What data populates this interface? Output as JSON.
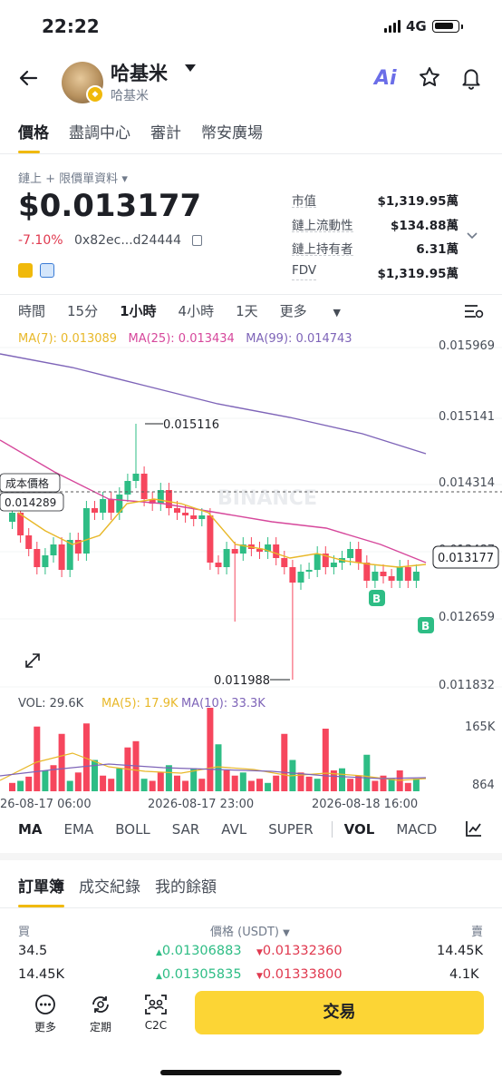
{
  "status_bar": {
    "time": "22:22",
    "network": "4G"
  },
  "header": {
    "token_name": "哈基米",
    "token_sub": "哈基米",
    "ai_label": "Ai",
    "icons": [
      "back-arrow-icon",
      "star-icon",
      "bell-icon"
    ]
  },
  "tabs": [
    "價格",
    "盡調中心",
    "審計",
    "幣安廣場"
  ],
  "price_section": {
    "source_label": "鏈上 + 限價單資料",
    "price": "$0.013177",
    "change": "-7.10%",
    "address": "0x82ec...d24444"
  },
  "stats": [
    {
      "label": "市值",
      "value": "$1,319.95萬"
    },
    {
      "label": "鏈上流動性",
      "value": "$134.88萬"
    },
    {
      "label": "鏈上持有者",
      "value": "6.31萬"
    },
    {
      "label": "FDV",
      "value": "$1,319.95萬"
    }
  ],
  "intervals": [
    "時間",
    "15分",
    "1小時",
    "4小時",
    "1天",
    "更多"
  ],
  "active_interval": "1小時",
  "ma_legend": {
    "ma7": "MA(7): 0.013089",
    "ma25": "MA(25): 0.013434",
    "ma99": "MA(99): 0.014743",
    "colors": {
      "ma7": "#e8b829",
      "ma25": "#d6479b",
      "ma99": "#7e64b8"
    }
  },
  "chart_data": {
    "type": "candlestick",
    "y_ticks": [
      "0.015969",
      "0.015141",
      "0.014314",
      "0.013487",
      "0.012659",
      "0.011832"
    ],
    "high_label": "0.015116",
    "low_label": "0.011988",
    "cost_label": "成本價格",
    "cost_value": "0.014289",
    "current_value": "0.013177",
    "x_ticks": [
      "26-08-17 06:00",
      "2026-08-17 23:00",
      "2026-08-18 16:00"
    ],
    "watermark": "BINANCE",
    "marker": "B",
    "colors": {
      "up": "#2ebd85",
      "down": "#f6465d"
    }
  },
  "volume_legend": {
    "vol": "VOL: 29.6K",
    "ma5": "MA(5): 17.9K",
    "ma10": "MA(10): 33.3K"
  },
  "volume_ticks": [
    "165K",
    "864"
  ],
  "indicator_tabs": [
    "MA",
    "EMA",
    "BOLL",
    "SAR",
    "AVL",
    "SUPER",
    "VOL",
    "MACD"
  ],
  "orderbook": {
    "tabs": [
      "訂單簿",
      "成交紀錄",
      "我的餘額"
    ],
    "head_buy": "買",
    "head_price": "價格 (USDT)",
    "head_sell": "賣",
    "rows": [
      {
        "buy_qty": "34.5",
        "bid": "0.01306883",
        "ask": "0.01332360",
        "sell_qty": "14.45K"
      },
      {
        "buy_qty": "14.45K",
        "bid": "0.01305835",
        "ask": "0.01333800",
        "sell_qty": "4.1K"
      }
    ]
  },
  "bottom_bar": {
    "items": [
      "更多",
      "定期",
      "C2C"
    ],
    "trade": "交易"
  }
}
